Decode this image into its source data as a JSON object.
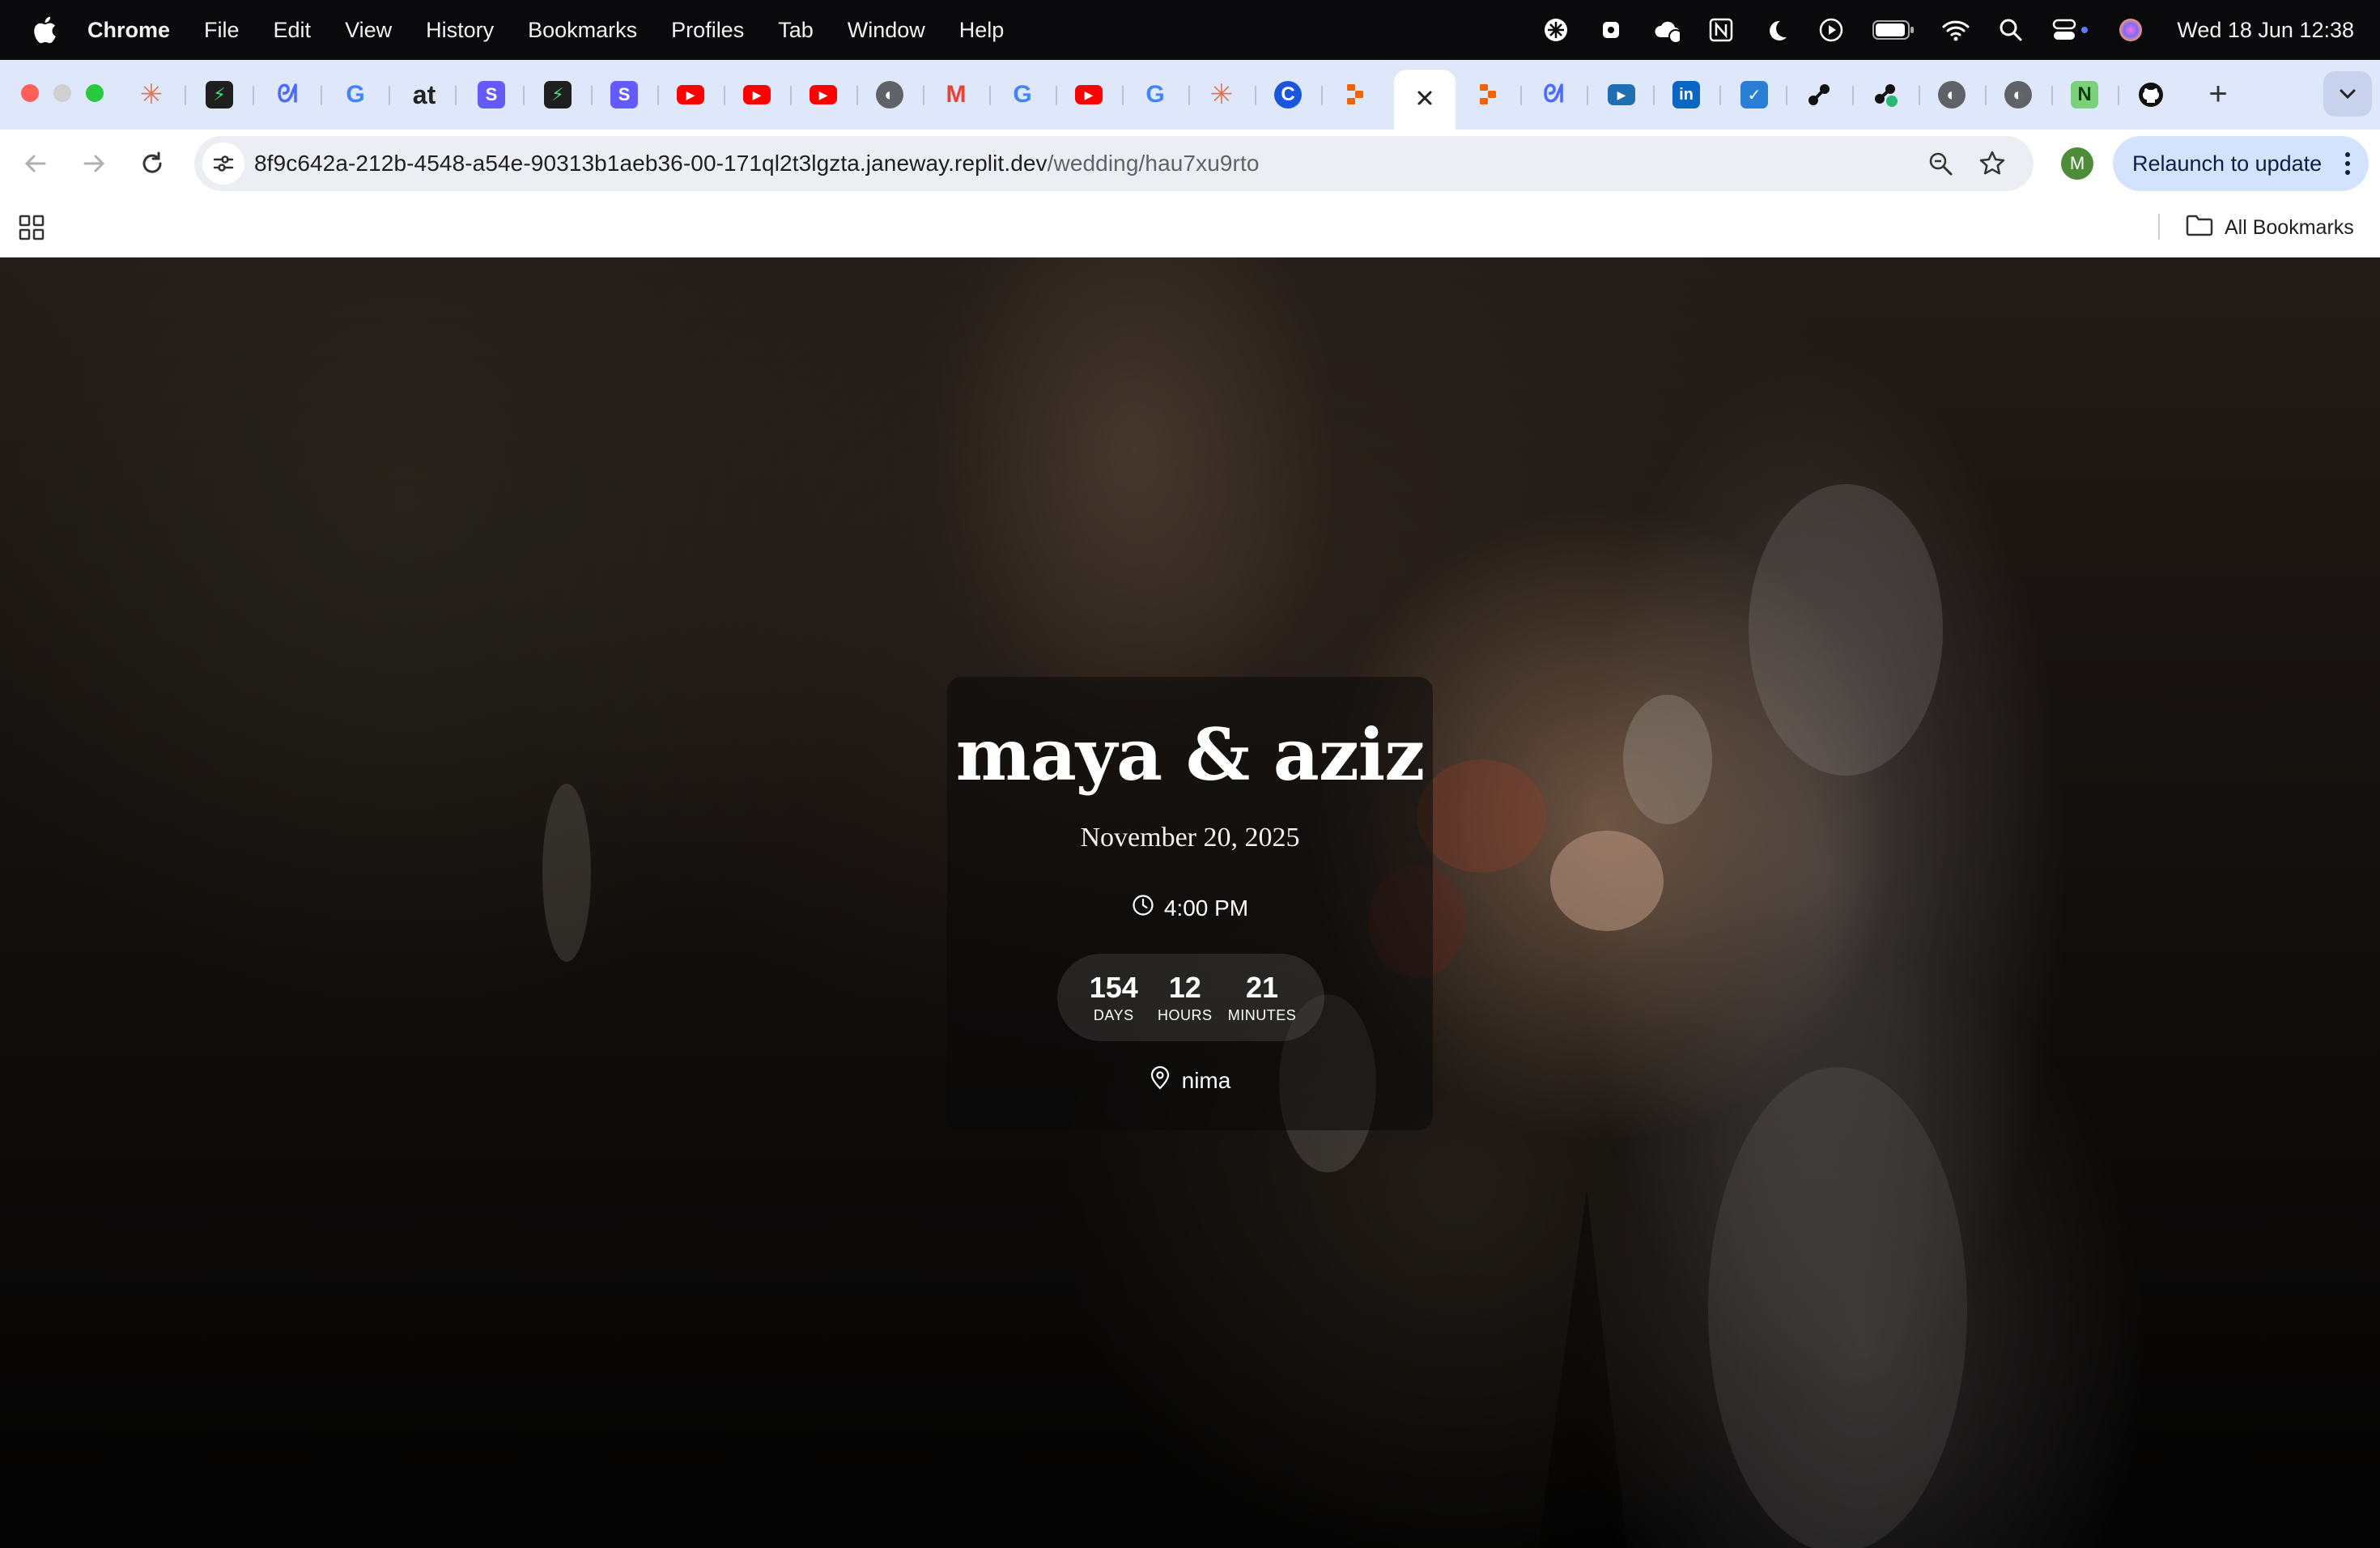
{
  "menubar": {
    "app": "Chrome",
    "items": [
      "File",
      "Edit",
      "View",
      "History",
      "Bookmarks",
      "Profiles",
      "Tab",
      "Window",
      "Help"
    ],
    "clock": "Wed 18 Jun  12:38"
  },
  "browser": {
    "url_host": "8f9c642a-212b-4548-a54e-90313b1aeb36-00-171ql2t3lgzta.janeway.replit.dev",
    "url_path": "/wedding/hau7xu9rto",
    "relaunch_label": "Relaunch to update",
    "avatar_initial": "M",
    "all_bookmarks_label": "All Bookmarks"
  },
  "wedding": {
    "couple_names": "maya & aziz",
    "date": "November 20, 2025",
    "time": "4:00 PM",
    "countdown": [
      {
        "value": "154",
        "label": "DAYS"
      },
      {
        "value": "12",
        "label": "HOURS"
      },
      {
        "value": "21",
        "label": "MINUTES"
      }
    ],
    "venue": "nima"
  },
  "colors": {
    "accent_relaunch": "#d3e3fd",
    "tabstrip": "#dfe7fb",
    "avatar": "#4e8c3a"
  }
}
